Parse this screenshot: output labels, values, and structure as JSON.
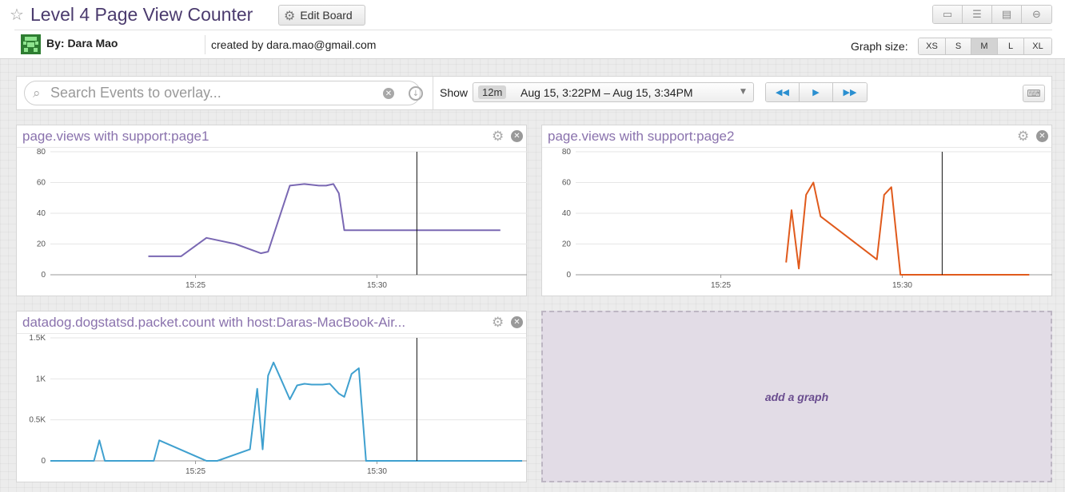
{
  "header": {
    "title": "Level 4 Page View Counter",
    "edit_board_label": "Edit Board",
    "author": "By: Dara Mao",
    "created_by": "created by dara.mao@gmail.com",
    "graph_size_label": "Graph size:",
    "graph_sizes": [
      "XS",
      "S",
      "M",
      "L",
      "XL"
    ],
    "active_graph_size": "M",
    "view_buttons": [
      "tv-mode-icon",
      "list-view-icon",
      "report-view-icon",
      "remove-icon"
    ]
  },
  "toolbar": {
    "search_placeholder": "Search Events to overlay...",
    "show_label": "Show",
    "time_window": "12m",
    "time_range": "Aug 15, 3:22PM – Aug 15, 3:34PM",
    "nav_buttons": [
      "rewind-icon",
      "play-icon",
      "fast-forward-icon"
    ]
  },
  "add_graph_label": "add a graph",
  "colors": {
    "title": "#4b3b6e",
    "panel_title": "#8a72ad",
    "series_purple": "#7a68b3",
    "series_orange": "#e05a1c",
    "series_blue": "#3fa0cf",
    "nav_blue": "#2a8fd0"
  },
  "chart_data": [
    {
      "type": "line",
      "title": "page.views with support:page1",
      "xlim": [
        "15:21",
        "15:34"
      ],
      "x_ticks": [
        "15:25",
        "15:30"
      ],
      "ylim": [
        0,
        80
      ],
      "y_ticks": [
        "0",
        "20",
        "40",
        "60",
        "80"
      ],
      "marker_time": "15:31.1",
      "series": [
        {
          "color": "#7a68b3",
          "x": [
            "15:23.7",
            "15:24.4",
            "15:24.6",
            "15:25.3",
            "15:26.1",
            "15:26.8",
            "15:27.0",
            "15:27.6",
            "15:28.0",
            "15:28.2",
            "15:28.4",
            "15:28.6",
            "15:28.8",
            "15:28.95",
            "15:29.1",
            "15:30.0",
            "15:33.4"
          ],
          "values": [
            12,
            12,
            12,
            24,
            20,
            14,
            15,
            58,
            59,
            58.5,
            58,
            58,
            59,
            53,
            29,
            29,
            29
          ]
        }
      ]
    },
    {
      "type": "line",
      "title": "page.views with support:page2",
      "xlim": [
        "15:21",
        "15:34"
      ],
      "x_ticks": [
        "15:25",
        "15:30"
      ],
      "ylim": [
        0,
        80
      ],
      "y_ticks": [
        "0",
        "20",
        "40",
        "60",
        "80"
      ],
      "marker_time": "15:31.1",
      "series": [
        {
          "color": "#e05a1c",
          "x": [
            "15:26.8",
            "15:26.95",
            "15:27.15",
            "15:27.35",
            "15:27.55",
            "15:27.75",
            "15:29.3",
            "15:29.5",
            "15:29.7",
            "15:29.95",
            "15:30.2",
            "15:33.5"
          ],
          "values": [
            8,
            42,
            4,
            52,
            60,
            38,
            10,
            52,
            57,
            0,
            0,
            0
          ]
        }
      ]
    },
    {
      "type": "line",
      "title": "datadog.dogstatsd.packet.count with host:Daras-MacBook-Air...",
      "xlim": [
        "15:21",
        "15:34"
      ],
      "x_ticks": [
        "15:25",
        "15:30"
      ],
      "ylim": [
        0,
        1500
      ],
      "y_ticks": [
        "0",
        "0.5K",
        "1K",
        "1.5K"
      ],
      "marker_time": "15:31.1",
      "series": [
        {
          "color": "#3fa0cf",
          "x": [
            "15:21",
            "15:22.2",
            "15:22.35",
            "15:22.5",
            "15:23.7",
            "15:23.85",
            "15:24.0",
            "15:25.3",
            "15:25.45",
            "15:25.6",
            "15:26.5",
            "15:26.7",
            "15:26.85",
            "15:27.0",
            "15:27.15",
            "15:27.35",
            "15:27.6",
            "15:27.8",
            "15:28.0",
            "15:28.2",
            "15:28.5",
            "15:28.7",
            "15:28.95",
            "15:29.1",
            "15:29.3",
            "15:29.5",
            "15:29.7",
            "15:30.0",
            "15:34"
          ],
          "values": [
            0,
            0,
            250,
            0,
            0,
            0,
            250,
            0,
            0,
            0,
            140,
            880,
            140,
            1040,
            1200,
            1000,
            750,
            920,
            940,
            930,
            930,
            940,
            820,
            780,
            1060,
            1130,
            0,
            0,
            0
          ]
        }
      ]
    }
  ]
}
